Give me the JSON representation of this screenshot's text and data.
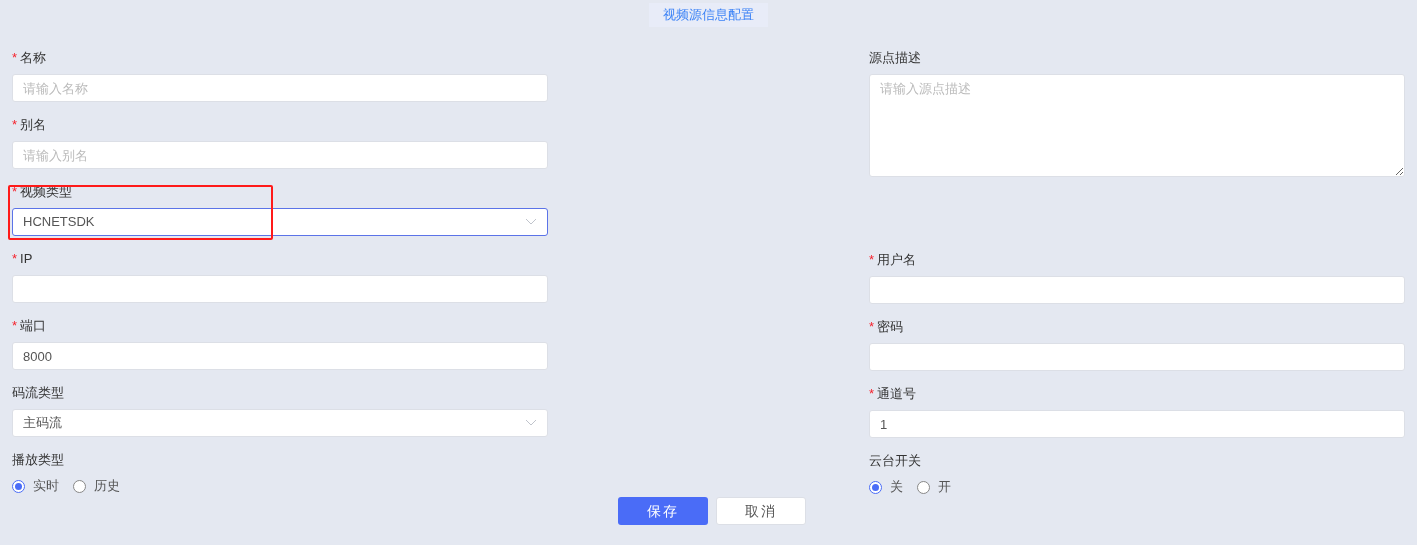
{
  "title": "视频源信息配置",
  "left_fields": [
    {
      "kind": "input",
      "required_mark": "*",
      "label": "名称",
      "placeholder": "请输入名称"
    },
    {
      "kind": "input",
      "required_mark": "*",
      "label": "别名",
      "placeholder": "请输入别名"
    },
    {
      "kind": "select",
      "required_mark": "*",
      "label": "视频类型",
      "value": "HCNETSDK",
      "focused": true
    },
    {
      "kind": "input",
      "required_mark": "*",
      "label": "IP"
    },
    {
      "kind": "input",
      "required_mark": "*",
      "label": "端口",
      "value": "8000"
    },
    {
      "kind": "select",
      "label": "码流类型",
      "value": "主码流",
      "focused": false
    },
    {
      "kind": "radio",
      "label": "播放类型",
      "options": [
        {
          "label": "实时",
          "selected": true
        },
        {
          "label": "历史",
          "selected": false
        }
      ]
    }
  ],
  "right_fields": [
    {
      "kind": "textarea",
      "label": "源点描述",
      "placeholder": "请输入源点描述"
    },
    {
      "kind": "input",
      "required_mark": "*",
      "label": "用户名"
    },
    {
      "kind": "input",
      "required_mark": "*",
      "label": "密码"
    },
    {
      "kind": "input",
      "required_mark": "*",
      "label": "通道号",
      "value": "1"
    },
    {
      "kind": "radio",
      "label": "云台开关",
      "options": [
        {
          "label": "关",
          "selected": true
        },
        {
          "label": "开",
          "selected": false
        }
      ]
    }
  ],
  "buttons": [
    {
      "label": "保存",
      "kind": "primary"
    },
    {
      "label": "取消",
      "kind": "secondary"
    }
  ]
}
